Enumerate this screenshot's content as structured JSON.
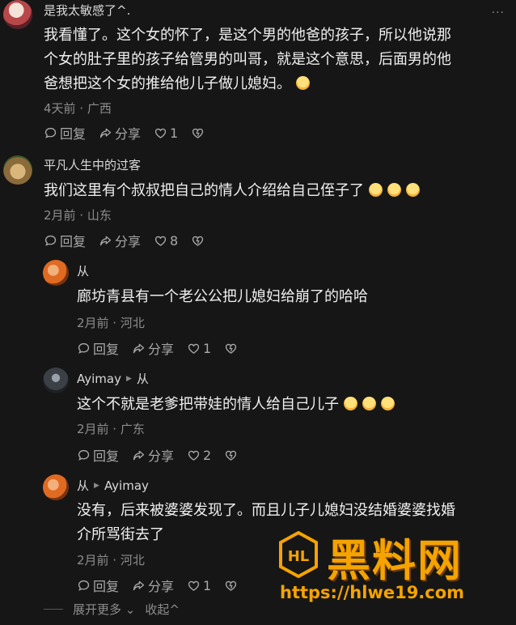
{
  "comments": [
    {
      "name": "是我太敏感了^.",
      "text_lines": [
        "我看懂了。这个女的怀了，是这个男的他爸的孩子，所以他说那",
        "个女的肚子里的孩子给管男的叫哥，就是这个意思，后面男的他",
        "爸想把这个女的推给他儿子做儿媳妇。"
      ],
      "meta": "4天前 · 广西",
      "reply_label": "回复",
      "share_label": "分享",
      "likes": "1"
    },
    {
      "name": "平凡人生中的过客",
      "text": "我们这里有个叔叔把自己的情人介绍给自己侄子了",
      "meta": "2月前 · 山东",
      "reply_label": "回复",
      "share_label": "分享",
      "likes": "8"
    },
    {
      "name": "从",
      "text": "廊坊青县有一个老公公把儿媳妇给崩了的哈哈",
      "meta": "2月前 · 河北",
      "reply_label": "回复",
      "share_label": "分享",
      "likes": "1"
    },
    {
      "name": "Ayimay",
      "reply_to": "从",
      "text": "这个不就是老爹把带娃的情人给自己儿子",
      "meta": "2月前 · 广东",
      "reply_label": "回复",
      "share_label": "分享",
      "likes": "2"
    },
    {
      "name": "从",
      "reply_to": "Ayimay",
      "text_lines": [
        "没有，后来被婆婆发现了。而且儿子儿媳妇没结婚婆婆找婚",
        "介所骂街去了"
      ],
      "meta": "2月前 · 河北",
      "reply_label": "回复",
      "share_label": "分享",
      "likes": "1"
    }
  ],
  "footer": {
    "expand": "展开更多",
    "collapse": "收起"
  },
  "watermark": {
    "title": "黑料网",
    "url": "https://hlwe19.com",
    "logo_text": "HL"
  },
  "icons": [
    "comment-icon",
    "share-icon",
    "heart-icon",
    "dislike-heart-icon",
    "more-dots-icon",
    "chevron-down-icon",
    "chevron-up-icon"
  ],
  "colors": {
    "background": "#161616",
    "watermark": "#f5a300"
  }
}
